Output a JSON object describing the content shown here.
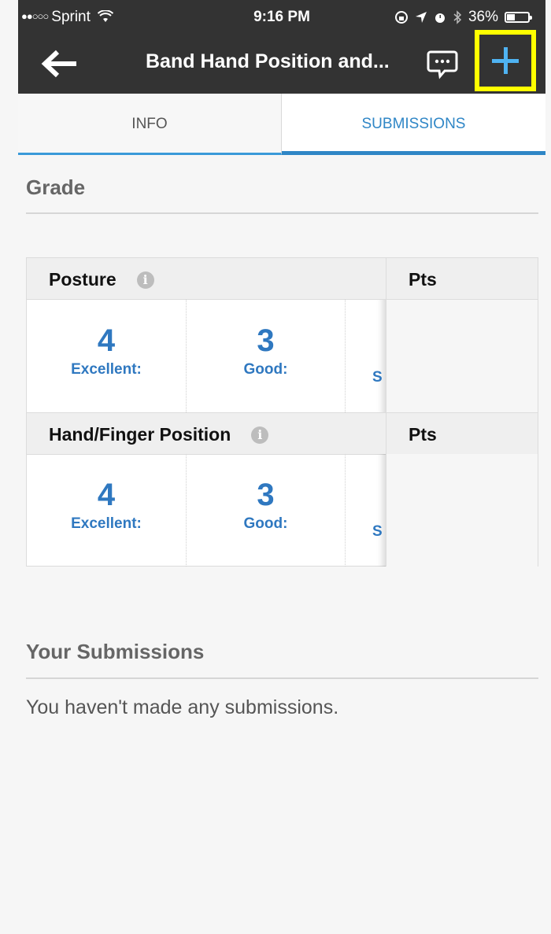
{
  "status_bar": {
    "carrier": "Sprint",
    "signal": "●●○○○",
    "time": "9:16 PM",
    "battery": "36%",
    "battery_level": 0.36
  },
  "header": {
    "title": "Band Hand Position and...",
    "icons": [
      "back-arrow-icon",
      "chat-icon",
      "plus-icon"
    ]
  },
  "tabs": [
    {
      "label": "INFO",
      "selected": false
    },
    {
      "label": "SUBMISSIONS",
      "selected": true
    }
  ],
  "grade": {
    "title": "Grade",
    "criteria": [
      {
        "name": "Posture",
        "pts_label": "Pts",
        "levels": [
          {
            "score": "4",
            "label": "Excellent:"
          },
          {
            "score": "3",
            "label": "Good:"
          },
          {
            "partial": "S"
          }
        ]
      },
      {
        "name": "Hand/Finger Position",
        "pts_label": "Pts",
        "levels": [
          {
            "score": "4",
            "label": "Excellent:"
          },
          {
            "score": "3",
            "label": "Good:"
          },
          {
            "partial": "S"
          }
        ]
      }
    ]
  },
  "submissions": {
    "title": "Your Submissions",
    "empty_message": "You haven't made any submissions."
  },
  "colors": {
    "header_bg": "#333333",
    "accent_blue": "#2f78c0",
    "highlight": "#ffff00",
    "plus_blue": "#4fb3f2"
  }
}
